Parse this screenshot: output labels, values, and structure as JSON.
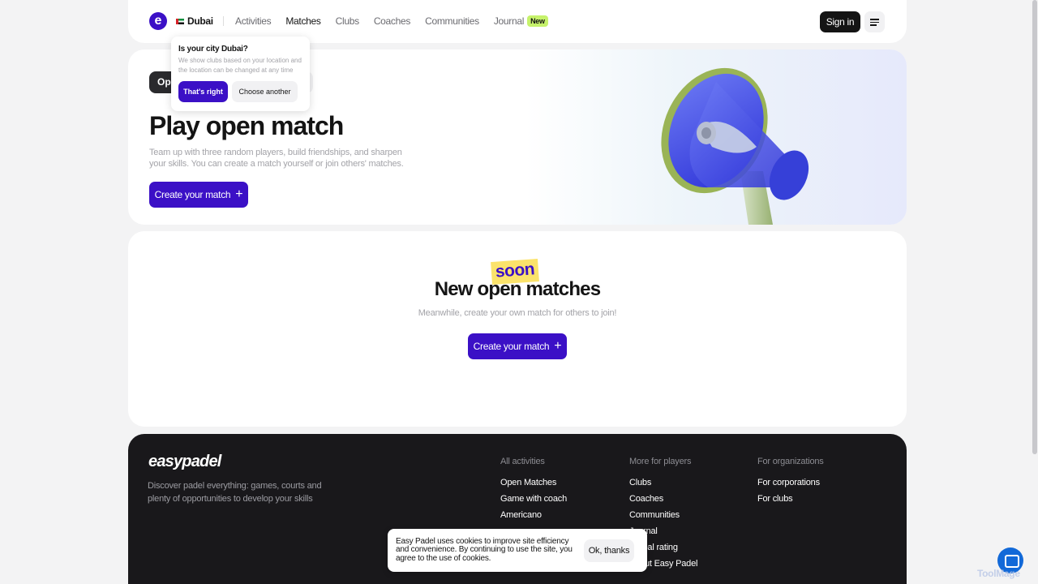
{
  "header": {
    "city": "Dubai",
    "nav": [
      {
        "label": "Activities"
      },
      {
        "label": "Matches"
      },
      {
        "label": "Clubs"
      },
      {
        "label": "Coaches"
      },
      {
        "label": "Communities"
      }
    ],
    "journal_label": "Journal",
    "new_badge": "New",
    "signin_label": "Sign in"
  },
  "popup": {
    "title": "Is your city Dubai?",
    "text": "We show clubs based on your location and the location can be changed at any time",
    "yes_label": "That's right",
    "no_label": "Choose another"
  },
  "hero": {
    "pill_label": "Op",
    "title": "Play open match",
    "description": "Team up with three random players, build friendships, and sharpen your skills. You can create a match yourself or join others' matches.",
    "button_label": "Create your match"
  },
  "matches": {
    "soon": "soon",
    "title": "New open matches",
    "subtitle": "Meanwhile, create your own match for others to join!",
    "button_label": "Create your match"
  },
  "footer": {
    "logo": "easypadel",
    "tagline": "Discover padel everything: games, courts and plenty of opportunities to develop your skills",
    "columns": [
      {
        "heading": "All activities",
        "items": [
          "Open Matches",
          "Game with coach",
          "Americano"
        ]
      },
      {
        "heading": "More for players",
        "items": [
          "Clubs",
          "Coaches",
          "Communities",
          "Journal",
          "Global rating",
          "About Easy Padel"
        ]
      },
      {
        "heading": "For organizations",
        "items": [
          "For corporations",
          "For clubs"
        ]
      }
    ]
  },
  "cookie": {
    "text": "Easy Padel uses cookies to improve site efficiency and convenience. By continuing to use the site, you agree to the use of cookies.",
    "button_label": "Ok, thanks"
  },
  "watermark": "ToolMage",
  "colors": {
    "accent": "#3b10c6",
    "dark": "#141414",
    "footer_bg": "#19181b",
    "soon_bg": "#fbe36b",
    "new_badge": "#c6f26b"
  }
}
